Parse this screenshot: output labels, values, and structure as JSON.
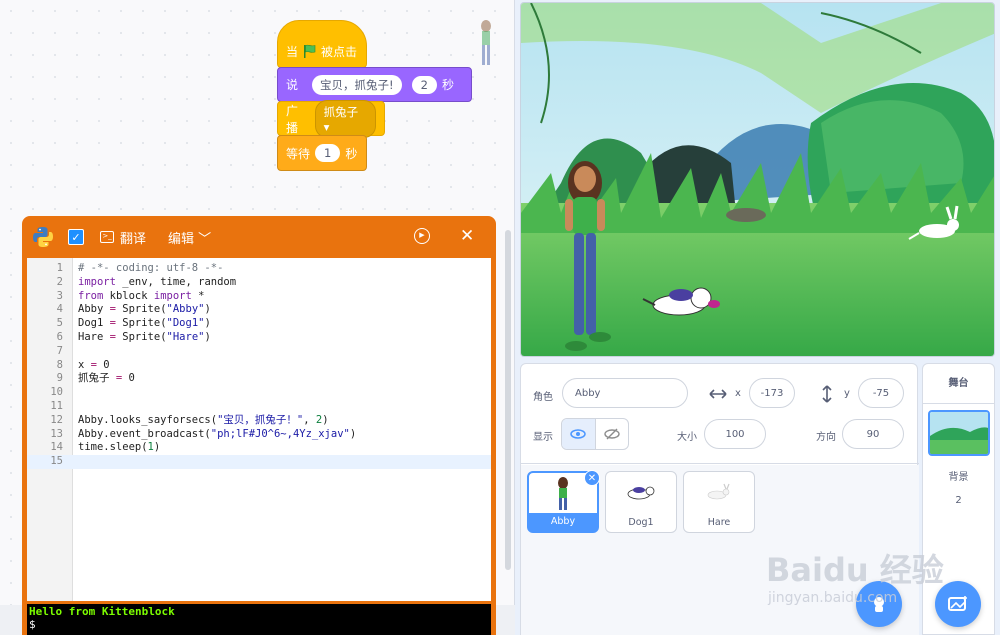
{
  "blocks": {
    "when_flag": {
      "label": "当",
      "suffix": "被点击"
    },
    "say": {
      "label": "说",
      "text": "宝贝，抓兔子!",
      "seconds": "2",
      "unit": "秒"
    },
    "broadcast": {
      "label": "广播",
      "message": "抓兔子"
    },
    "wait": {
      "label": "等待",
      "seconds": "1",
      "unit": "秒"
    }
  },
  "python_editor": {
    "translate_label": "翻译",
    "edit_label": "编辑",
    "lines": [
      {
        "n": "1",
        "text": "# -*- coding: utf-8 -*-"
      },
      {
        "n": "2",
        "text": "import _env, time, random"
      },
      {
        "n": "3",
        "text": "from kblock import *"
      },
      {
        "n": "4",
        "text": "Abby = Sprite(\"Abby\")"
      },
      {
        "n": "5",
        "text": "Dog1 = Sprite(\"Dog1\")"
      },
      {
        "n": "6",
        "text": "Hare = Sprite(\"Hare\")"
      },
      {
        "n": "7",
        "text": ""
      },
      {
        "n": "8",
        "text": "x = 0"
      },
      {
        "n": "9",
        "text": "抓兔子 = 0"
      },
      {
        "n": "10",
        "text": ""
      },
      {
        "n": "11",
        "text": ""
      },
      {
        "n": "12",
        "text": "Abby.looks_sayforsecs(\"宝贝，抓兔子！\", 2)"
      },
      {
        "n": "13",
        "text": "Abby.event_broadcast(\"ph;lF#J0^6~,4Yz_xjav\")"
      },
      {
        "n": "14",
        "text": "time.sleep(1)"
      },
      {
        "n": "15",
        "text": ""
      }
    ],
    "console_output": "Hello from Kittenblock",
    "console_prompt": "$"
  },
  "sprite_info": {
    "sprite_label": "角色",
    "sprite_name": "Abby",
    "x_label": "x",
    "x_value": "-173",
    "y_label": "y",
    "y_value": "-75",
    "show_label": "显示",
    "size_label": "大小",
    "size_value": "100",
    "direction_label": "方向",
    "direction_value": "90"
  },
  "sprites": [
    {
      "name": "Abby",
      "selected": true
    },
    {
      "name": "Dog1",
      "selected": false
    },
    {
      "name": "Hare",
      "selected": false
    }
  ],
  "stage_panel": {
    "title": "舞台",
    "backdrop_label": "背景",
    "backdrop_count": "2"
  },
  "watermark": {
    "brand": "Baidu 经验",
    "url": "jingyan.baidu.com"
  },
  "colors": {
    "events": "#ffbf00",
    "looks": "#9966ff",
    "control": "#ffab19",
    "python_header": "#e9730e",
    "accent": "#4c97ff"
  }
}
